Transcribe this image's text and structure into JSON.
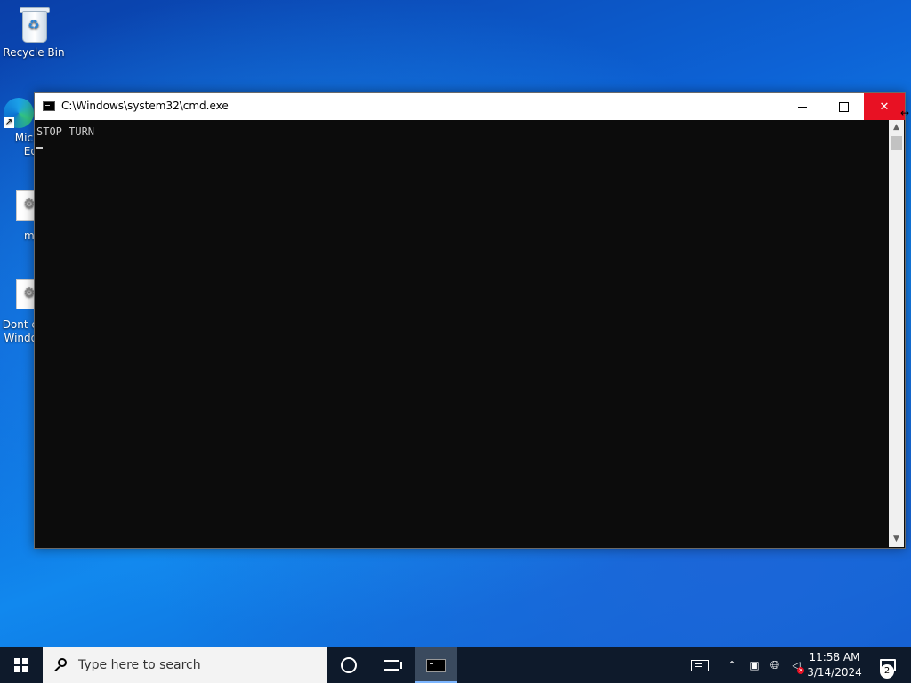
{
  "desktop": {
    "icons": [
      {
        "label": "Recycle Bin"
      },
      {
        "label": "Micr\nEd"
      },
      {
        "label": "mi"
      },
      {
        "label": "Dont c\nWindo"
      }
    ]
  },
  "window": {
    "title": "C:\\Windows\\system32\\cmd.exe",
    "icon": "cmd-icon",
    "controls": {
      "minimize": "minimize-icon",
      "maximize": "maximize-icon",
      "close": "close-icon"
    },
    "console_lines": [
      "STOP TURN"
    ]
  },
  "taskbar": {
    "search_placeholder": "Type here to search",
    "clock_time": "11:58 AM",
    "clock_date": "3/14/2024",
    "notification_count": "2",
    "accent": "#e81123"
  }
}
